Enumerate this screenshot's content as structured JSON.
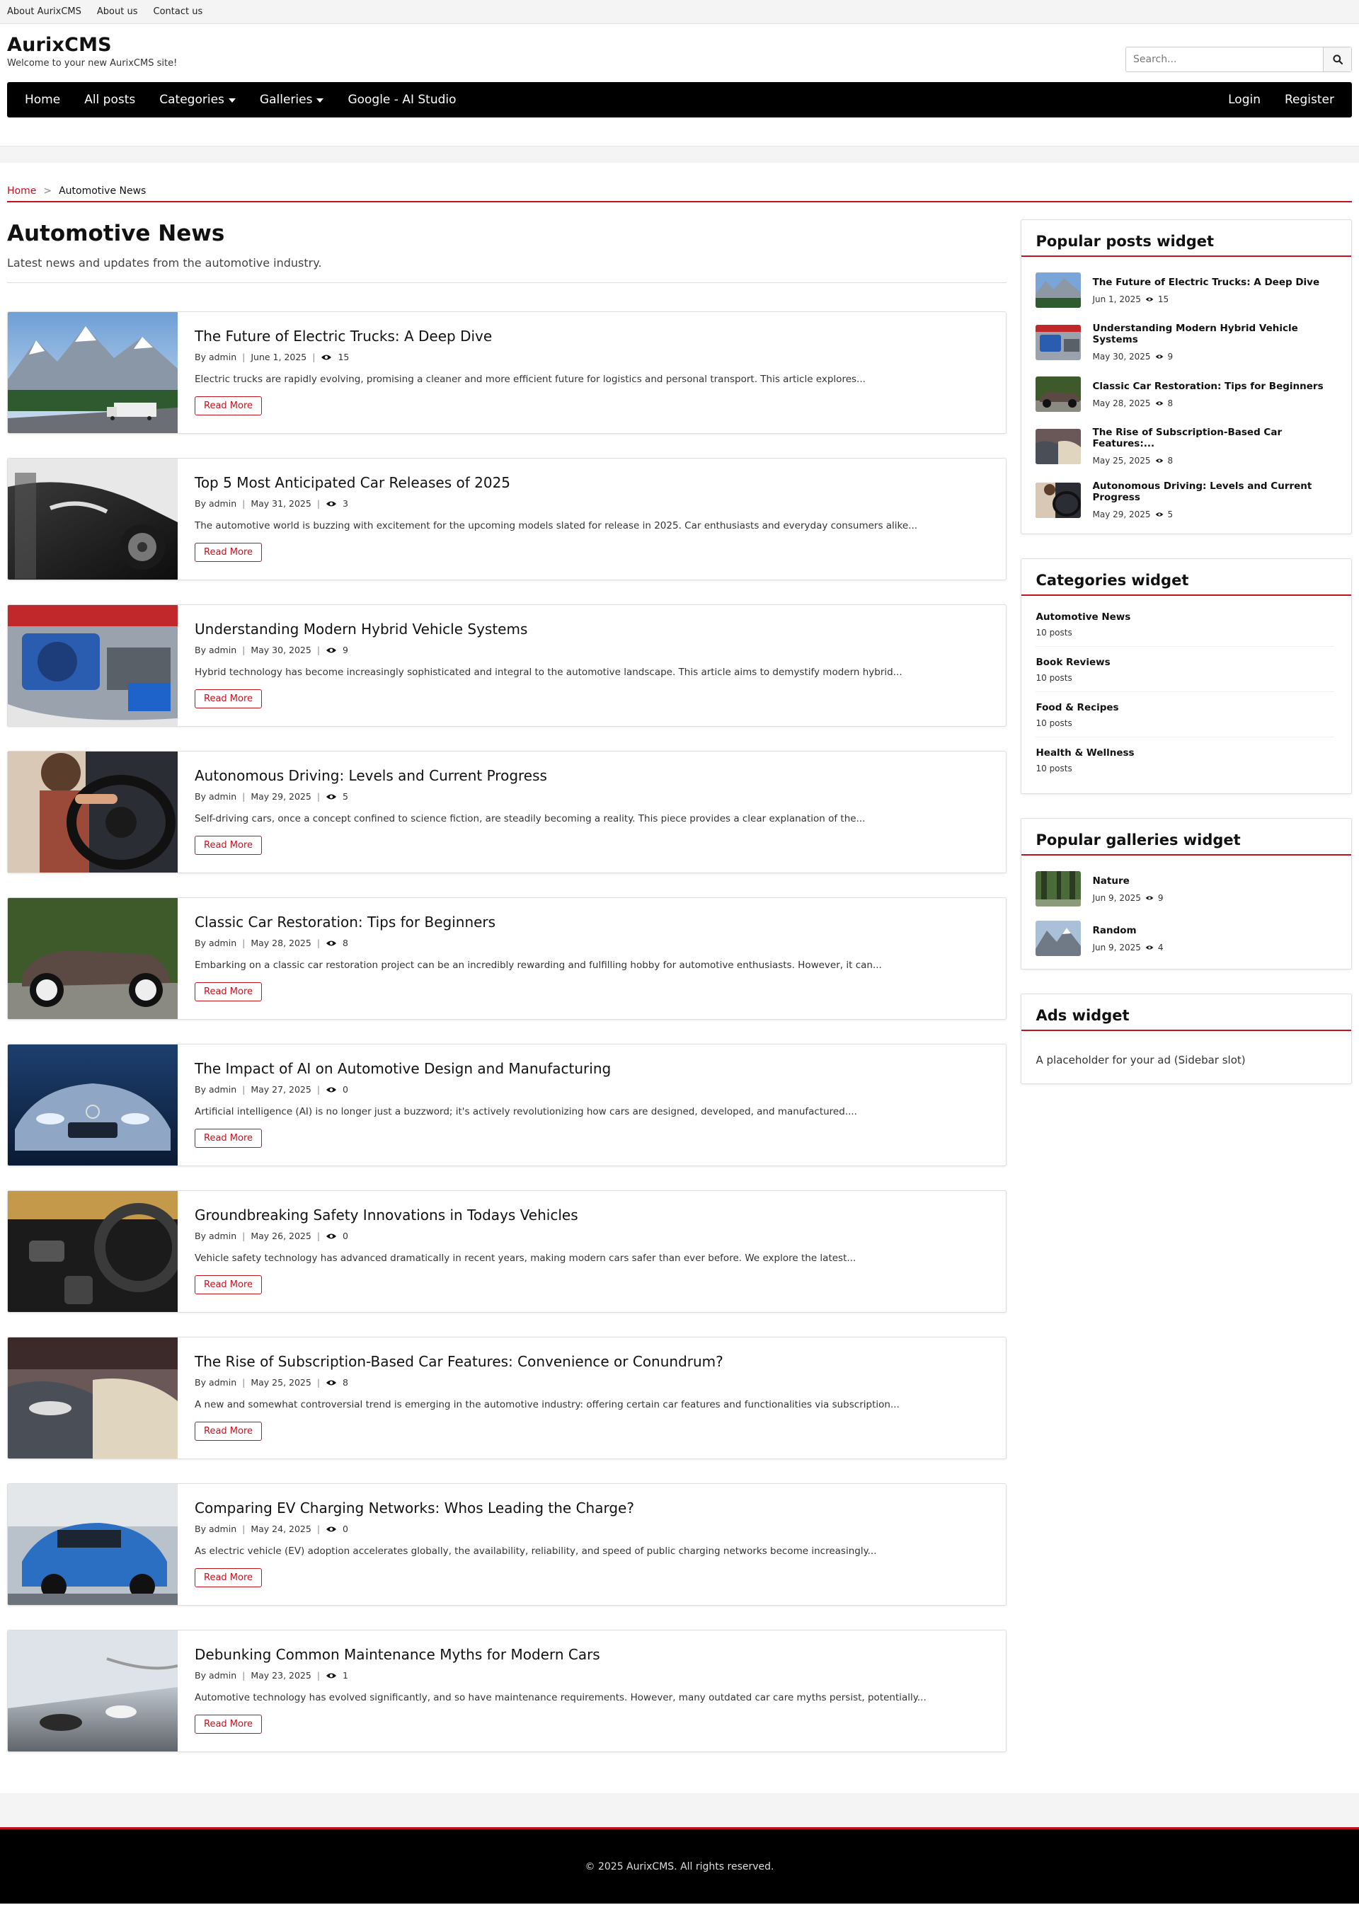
{
  "topbar": {
    "links": [
      "About AurixCMS",
      "About us",
      "Contact us"
    ]
  },
  "header": {
    "title": "AurixCMS",
    "tagline": "Welcome to your new AurixCMS site!",
    "search_placeholder": "Search...",
    "search_icon": "search-icon"
  },
  "nav": {
    "items": [
      "Home",
      "All posts",
      "Categories",
      "Galleries",
      "Google - AI Studio"
    ],
    "login": "Login",
    "register": "Register"
  },
  "breadcrumb": {
    "home": "Home",
    "separator": ">",
    "current": "Automotive News"
  },
  "page": {
    "title": "Automotive News",
    "description": "Latest news and updates from the automotive industry."
  },
  "posts": [
    {
      "title": "The Future of Electric Trucks: A Deep Dive",
      "author": "By admin",
      "date": "June 1, 2025",
      "views": "15",
      "excerpt": "Electric trucks are rapidly evolving, promising a cleaner and more efficient future for logistics and personal transport. This article explores...",
      "read_more": "Read More"
    },
    {
      "title": "Top 5 Most Anticipated Car Releases of 2025",
      "author": "By admin",
      "date": "May 31, 2025",
      "views": "3",
      "excerpt": "The automotive world is buzzing with excitement for the upcoming models slated for release in 2025. Car enthusiasts and everyday consumers alike...",
      "read_more": "Read More"
    },
    {
      "title": "Understanding Modern Hybrid Vehicle Systems",
      "author": "By admin",
      "date": "May 30, 2025",
      "views": "9",
      "excerpt": "Hybrid technology has become increasingly sophisticated and integral to the automotive landscape. This article aims to demystify modern hybrid...",
      "read_more": "Read More"
    },
    {
      "title": "Autonomous Driving: Levels and Current Progress",
      "author": "By admin",
      "date": "May 29, 2025",
      "views": "5",
      "excerpt": "Self-driving cars, once a concept confined to science fiction, are steadily becoming a reality. This piece provides a clear explanation of the...",
      "read_more": "Read More"
    },
    {
      "title": "Classic Car Restoration: Tips for Beginners",
      "author": "By admin",
      "date": "May 28, 2025",
      "views": "8",
      "excerpt": "Embarking on a classic car restoration project can be an incredibly rewarding and fulfilling hobby for automotive enthusiasts. However, it can...",
      "read_more": "Read More"
    },
    {
      "title": "The Impact of AI on Automotive Design and Manufacturing",
      "author": "By admin",
      "date": "May 27, 2025",
      "views": "0",
      "excerpt": "Artificial intelligence (AI) is no longer just a buzzword; it's actively revolutionizing how cars are designed, developed, and manufactured....",
      "read_more": "Read More"
    },
    {
      "title": "Groundbreaking Safety Innovations in Todays Vehicles",
      "author": "By admin",
      "date": "May 26, 2025",
      "views": "0",
      "excerpt": "Vehicle safety technology has advanced dramatically in recent years, making modern cars safer than ever before. We explore the latest...",
      "read_more": "Read More"
    },
    {
      "title": "The Rise of Subscription-Based Car Features: Convenience or Conundrum?",
      "author": "By admin",
      "date": "May 25, 2025",
      "views": "8",
      "excerpt": "A new and somewhat controversial trend is emerging in the automotive industry: offering certain car features and functionalities via subscription...",
      "read_more": "Read More"
    },
    {
      "title": "Comparing EV Charging Networks: Whos Leading the Charge?",
      "author": "By admin",
      "date": "May 24, 2025",
      "views": "0",
      "excerpt": "As electric vehicle (EV) adoption accelerates globally, the availability, reliability, and speed of public charging networks become increasingly...",
      "read_more": "Read More"
    },
    {
      "title": "Debunking Common Maintenance Myths for Modern Cars",
      "author": "By admin",
      "date": "May 23, 2025",
      "views": "1",
      "excerpt": "Automotive technology has evolved significantly, and so have maintenance requirements. However, many outdated car care myths persist, potentially...",
      "read_more": "Read More"
    }
  ],
  "sidebar": {
    "popular_posts": {
      "title": "Popular posts widget",
      "items": [
        {
          "title": "The Future of Electric Trucks: A Deep Dive",
          "date": "Jun 1, 2025",
          "views": "15"
        },
        {
          "title": "Understanding Modern Hybrid Vehicle Systems",
          "date": "May 30, 2025",
          "views": "9"
        },
        {
          "title": "Classic Car Restoration: Tips for Beginners",
          "date": "May 28, 2025",
          "views": "8"
        },
        {
          "title": "The Rise of Subscription-Based Car Features:...",
          "date": "May 25, 2025",
          "views": "8"
        },
        {
          "title": "Autonomous Driving: Levels and Current Progress",
          "date": "May 29, 2025",
          "views": "5"
        }
      ]
    },
    "categories": {
      "title": "Categories widget",
      "items": [
        {
          "name": "Automotive News",
          "count": "10 posts"
        },
        {
          "name": "Book Reviews",
          "count": "10 posts"
        },
        {
          "name": "Food & Recipes",
          "count": "10 posts"
        },
        {
          "name": "Health & Wellness",
          "count": "10 posts"
        }
      ]
    },
    "galleries": {
      "title": "Popular galleries widget",
      "items": [
        {
          "name": "Nature",
          "date": "Jun 9, 2025",
          "views": "9"
        },
        {
          "name": "Random",
          "date": "Jun 9, 2025",
          "views": "4"
        }
      ]
    },
    "ads": {
      "title": "Ads widget",
      "text": "A placeholder for your ad (Sidebar slot)"
    }
  },
  "footer": {
    "copyright": "© 2025 AurixCMS. All rights reserved."
  },
  "colors": {
    "accent": "#c1121f",
    "nav_bg": "#000000",
    "footer_bg": "#000000"
  }
}
